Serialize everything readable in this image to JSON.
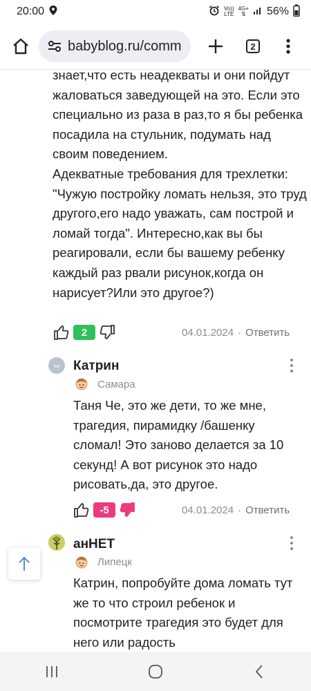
{
  "status_bar": {
    "time": "20:00",
    "volte_label": "Vo))",
    "lte_label": "LTE",
    "network": "4G+",
    "battery": "56%"
  },
  "browser": {
    "url": "babyblog.ru/comm",
    "tab_count": "2"
  },
  "first_comment": {
    "lines": [
      "знает,что есть неадекваты и они пойдут жаловаться заведующей на это. Если это специально из раза в раз,то я бы ребенка посадила на стульник, подумать над своим поведением.",
      "Адекватные требования для трехлетки: \"Чужую постройку ломать нельзя, это труд другого,его надо уважать, сам построй и ломай тогда\". Интересно,как вы бы реагировали, если бы вашему ребенку каждый раз рвали рисунок,когда он нарисует?Или это другое?)"
    ],
    "votes": "2",
    "date": "04.01.2024",
    "reply_label": "Ответить"
  },
  "comments": [
    {
      "author": "Катрин",
      "location": "Самара",
      "text": "Таня Че, это же дети, то же мне, трагедия, пирамидку /башенку сломал! Это заново делается за 10 секунд! А вот рисунок это надо рисовать,да, это другое.",
      "votes": "-5",
      "date": "04.01.2024",
      "reply_label": "Ответить"
    },
    {
      "author": "анНЕТ",
      "location": "Липецк",
      "text": "Катрин, попробуйте дома ломать тут же то что строил ребенок и посмотрите трагедия это будет для него или радость"
    }
  ],
  "separator": "·",
  "colors": {
    "positive": "#2fc05a",
    "negative": "#ec3a7c",
    "muted": "#8c8c8c"
  },
  "icons": {
    "home": "home-icon",
    "site_settings": "site-settings-icon",
    "new_tab": "plus-icon",
    "tabs": "tabs-icon",
    "menu": "more-vert-icon",
    "like": "thumbs-up-icon",
    "dislike": "thumbs-down-icon",
    "scroll_top": "arrow-up-icon"
  }
}
